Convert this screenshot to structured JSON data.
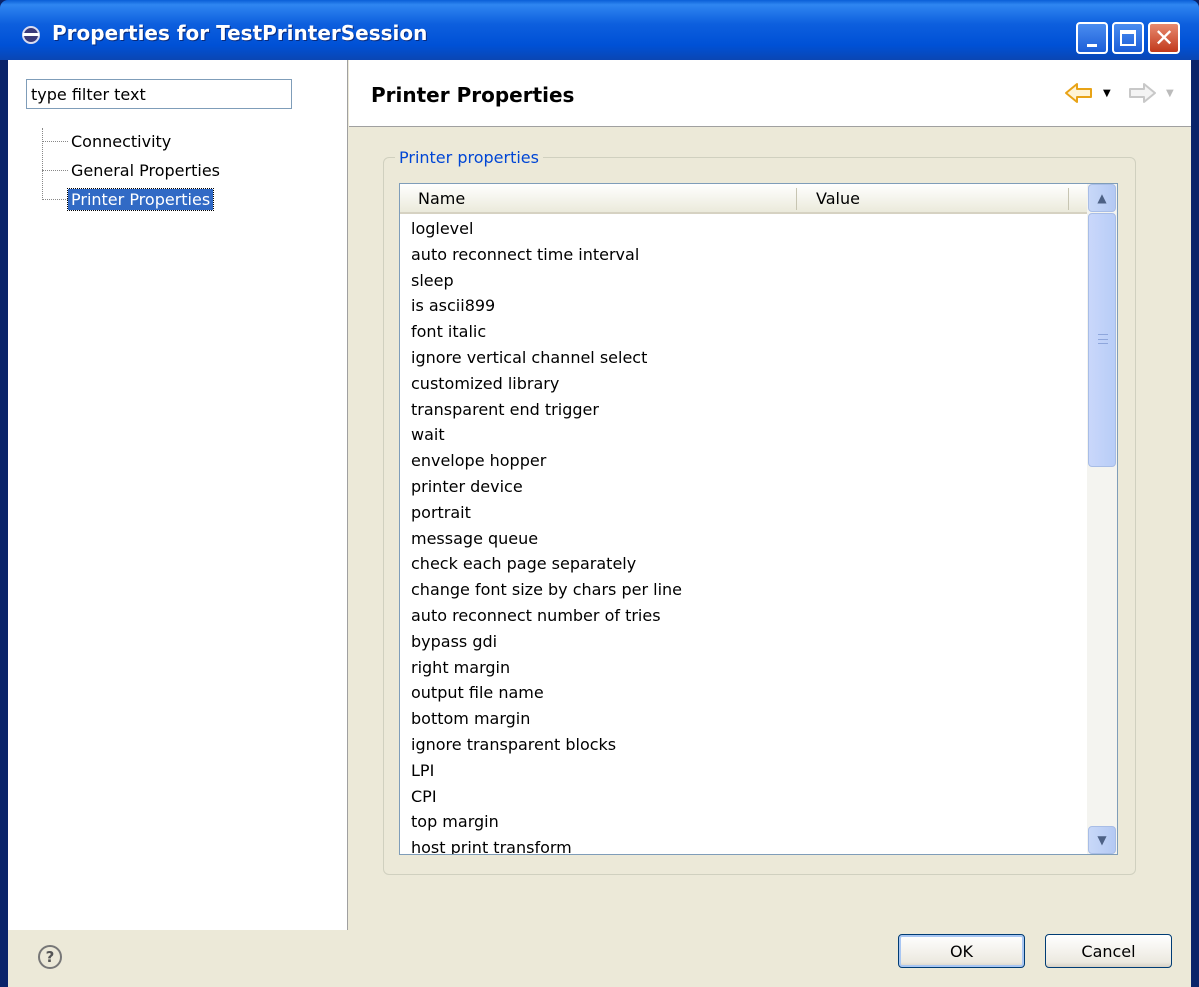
{
  "window": {
    "title": "Properties for TestPrinterSession",
    "controls": [
      "minimize-icon",
      "maximize-icon",
      "close-icon"
    ]
  },
  "left": {
    "filter_value": "type filter text",
    "tree": [
      {
        "label": "Connectivity",
        "selected": false
      },
      {
        "label": "General Properties",
        "selected": false
      },
      {
        "label": "Printer Properties",
        "selected": true
      }
    ]
  },
  "right": {
    "title": "Printer Properties",
    "nav": {
      "back": "back-arrow-icon",
      "forward": "forward-arrow-icon"
    },
    "group_label": "Printer properties",
    "table": {
      "columns": [
        "Name",
        "Value"
      ],
      "rows": [
        "loglevel",
        "auto reconnect time interval",
        "sleep",
        "is ascii899",
        "font italic",
        "ignore vertical channel select",
        "customized library",
        "transparent end trigger",
        "wait",
        "envelope hopper",
        "printer device",
        "portrait",
        "message queue",
        "check each page separately",
        "change font size by chars per line",
        "auto reconnect number of tries",
        "bypass gdi",
        "right margin",
        "output file name",
        "bottom margin",
        "ignore transparent blocks",
        "LPI",
        "CPI",
        "top margin",
        "host print transform"
      ]
    }
  },
  "footer": {
    "help": "?",
    "ok_label": "OK",
    "cancel_label": "Cancel"
  },
  "colors": {
    "titlebar": "#0058e6",
    "selection": "#316ac5",
    "group_label": "#0046d5",
    "nav_back_arrow": "#e8a317"
  }
}
